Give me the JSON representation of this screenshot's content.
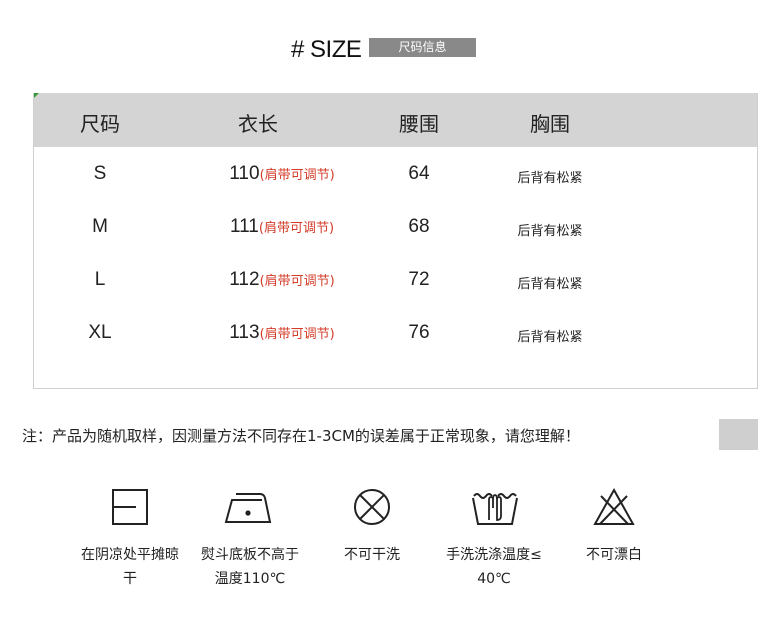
{
  "heading": {
    "title": "# SIZE",
    "badge": "尺码信息"
  },
  "table": {
    "headers": [
      "尺码",
      "衣长",
      "腰围",
      "胸围"
    ],
    "rows": [
      {
        "size": "S",
        "length": "110",
        "length_note": "(肩带可调节)",
        "waist": "64",
        "chest": "后背有松紧"
      },
      {
        "size": "M",
        "length": "111",
        "length_note": "(肩带可调节)",
        "waist": "68",
        "chest": "后背有松紧"
      },
      {
        "size": "L",
        "length": "112",
        "length_note": "(肩带可调节)",
        "waist": "72",
        "chest": "后背有松紧"
      },
      {
        "size": "XL",
        "length": "113",
        "length_note": "(肩带可调节)",
        "waist": "76",
        "chest": "后背有松紧"
      }
    ]
  },
  "note": "注：产品为随机取样，因测量方法不同存在1-3CM的误差属于正常现象，请您理解！",
  "care": [
    {
      "icon": "flat-dry-icon",
      "lines": [
        "在阴凉处平摊晾",
        "干"
      ]
    },
    {
      "icon": "iron-low-icon",
      "lines": [
        "熨斗底板不高于",
        "温度110℃"
      ]
    },
    {
      "icon": "no-dryclean-icon",
      "lines": [
        "不可干洗"
      ]
    },
    {
      "icon": "hand-wash-icon",
      "lines": [
        "手洗洗涤温度≤",
        "40℃"
      ]
    },
    {
      "icon": "no-bleach-icon",
      "lines": [
        "不可漂白"
      ]
    }
  ]
}
